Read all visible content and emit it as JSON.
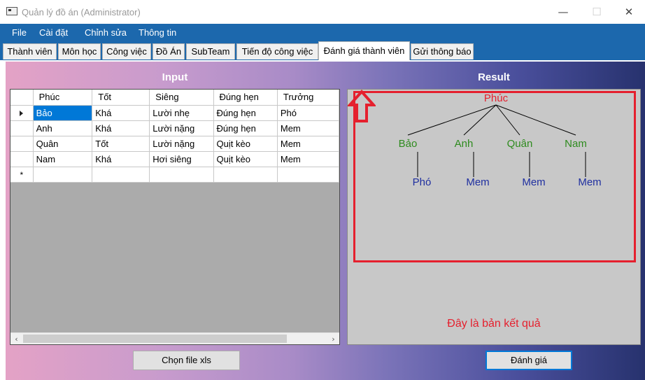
{
  "window": {
    "title": "Quản lý đồ án (Administrator)",
    "minimize": "—",
    "maximize": "☐",
    "close": "✕"
  },
  "menu": [
    "File",
    "Cài đặt",
    "Chỉnh sửa",
    "Thông tin"
  ],
  "tabs": [
    "Thành viên",
    "Môn học",
    "Công việc",
    "Đồ Án",
    "SubTeam",
    "Tiến độ công việc",
    "Đánh giá thành viên",
    "Gửi thông báo"
  ],
  "active_tab": "Đánh giá thành viên",
  "input": {
    "title": "Input",
    "columns": [
      "Phúc",
      "Tốt",
      "Siêng",
      "Đúng hẹn",
      "Trưởng"
    ],
    "rows": [
      [
        "Bảo",
        "Khá",
        "Lười nhẹ",
        "Đúng hẹn",
        "Phó"
      ],
      [
        "Anh",
        "Khá",
        "Lười nặng",
        "Đúng hẹn",
        "Mem"
      ],
      [
        "Quân",
        "Tốt",
        "Lười nặng",
        "Quịt kèo",
        "Mem"
      ],
      [
        "Nam",
        "Khá",
        "Hơi siêng",
        "Quịt kèo",
        "Mem"
      ]
    ],
    "new_row_marker": "*"
  },
  "result": {
    "title": "Result",
    "root": "Phúc",
    "children": [
      {
        "name": "Bảo",
        "leaf": "Phó"
      },
      {
        "name": "Anh",
        "leaf": "Mem"
      },
      {
        "name": "Quân",
        "leaf": "Mem"
      },
      {
        "name": "Nam",
        "leaf": "Mem"
      }
    ],
    "note": "Đây là bản kết quả"
  },
  "buttons": {
    "choose_file": "Chọn file xls",
    "evaluate": "Đánh giá"
  },
  "colors": {
    "menu_bg": "#1c68ad",
    "highlight": "#e5202e",
    "root": "#e5202e",
    "branch": "#2e8b1e",
    "leaf": "#1f2fa0",
    "selection": "#0078d7"
  }
}
